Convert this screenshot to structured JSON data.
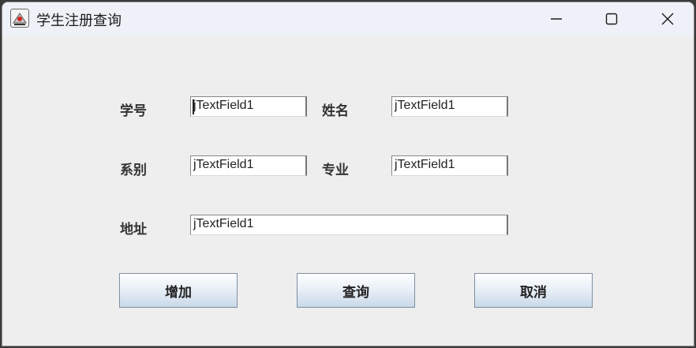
{
  "window": {
    "title": "学生注册查询",
    "controls": {
      "minimize": "minimize-icon",
      "maximize": "maximize-icon",
      "close": "close-icon"
    }
  },
  "form": {
    "student_id": {
      "label": "学号",
      "value": "jTextField1"
    },
    "name": {
      "label": "姓名",
      "value": "jTextField1"
    },
    "department": {
      "label": "系别",
      "value": "jTextField1"
    },
    "major": {
      "label": "专业",
      "value": "jTextField1"
    },
    "address": {
      "label": "地址",
      "value": "jTextField1"
    }
  },
  "buttons": {
    "add": "增加",
    "query": "查询",
    "cancel": "取消"
  }
}
